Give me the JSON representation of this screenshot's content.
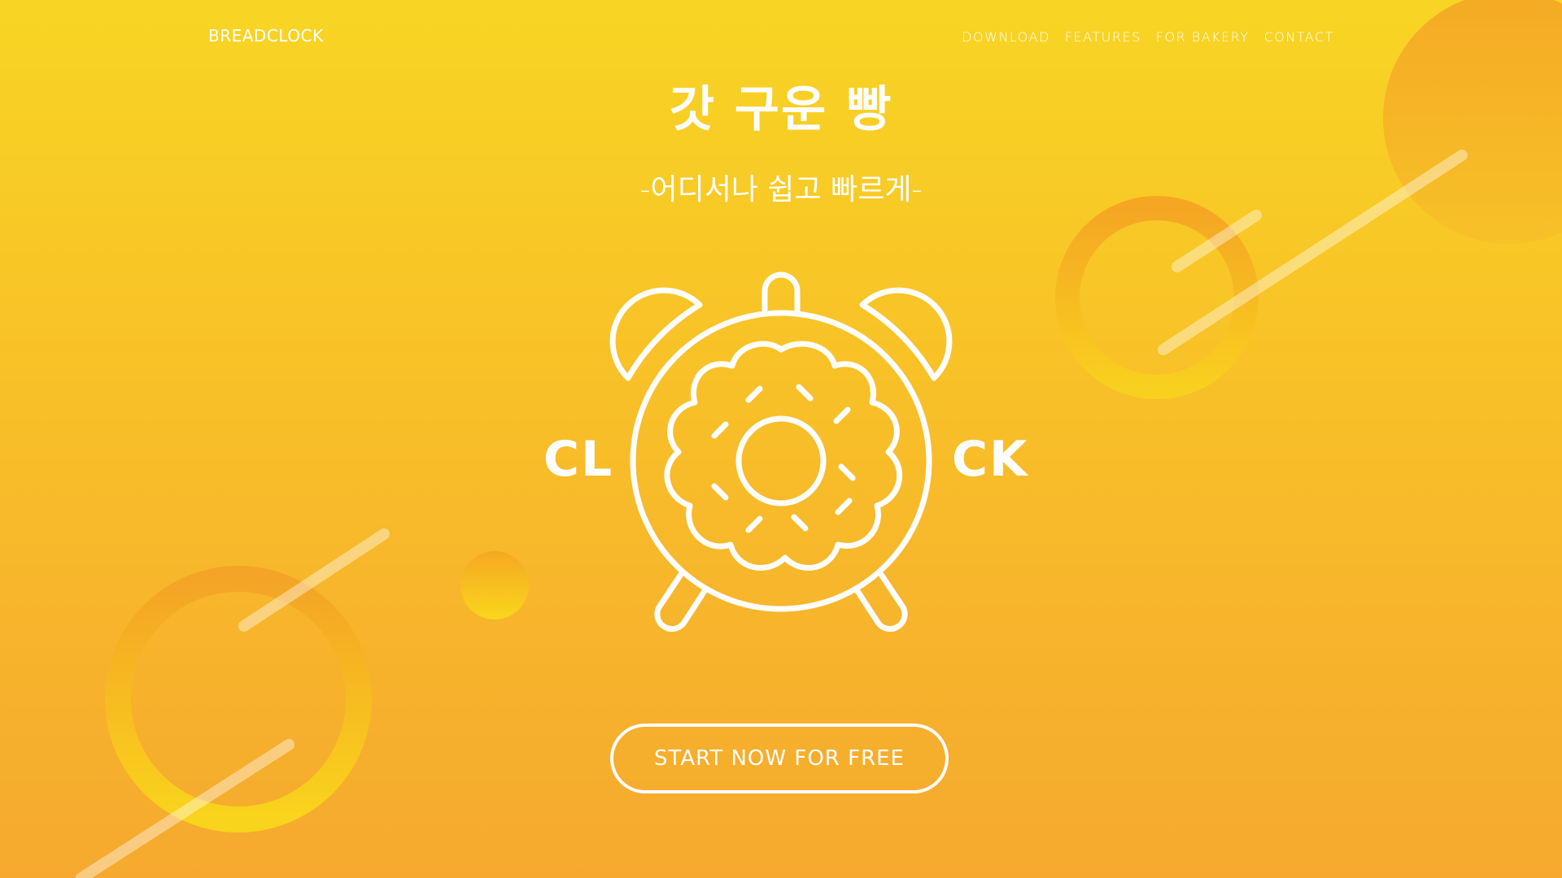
{
  "header": {
    "brand": "BREADCLOCK",
    "nav": [
      "DOWNLOAD",
      "FEATURES",
      "FOR BAKERY",
      "CONTACT"
    ]
  },
  "hero": {
    "title": "갓 구운 빵",
    "subtitle": "-어디서나 쉽고 빠르게-"
  },
  "logo": {
    "left_text": "CL",
    "right_text": "CK",
    "icon": "donut-alarm-clock-icon"
  },
  "cta": {
    "label": "START NOW FOR FREE"
  },
  "colors": {
    "background_top": "#F8D524",
    "background_bottom": "#F6A92E",
    "foreground": "#FFFFFF"
  }
}
